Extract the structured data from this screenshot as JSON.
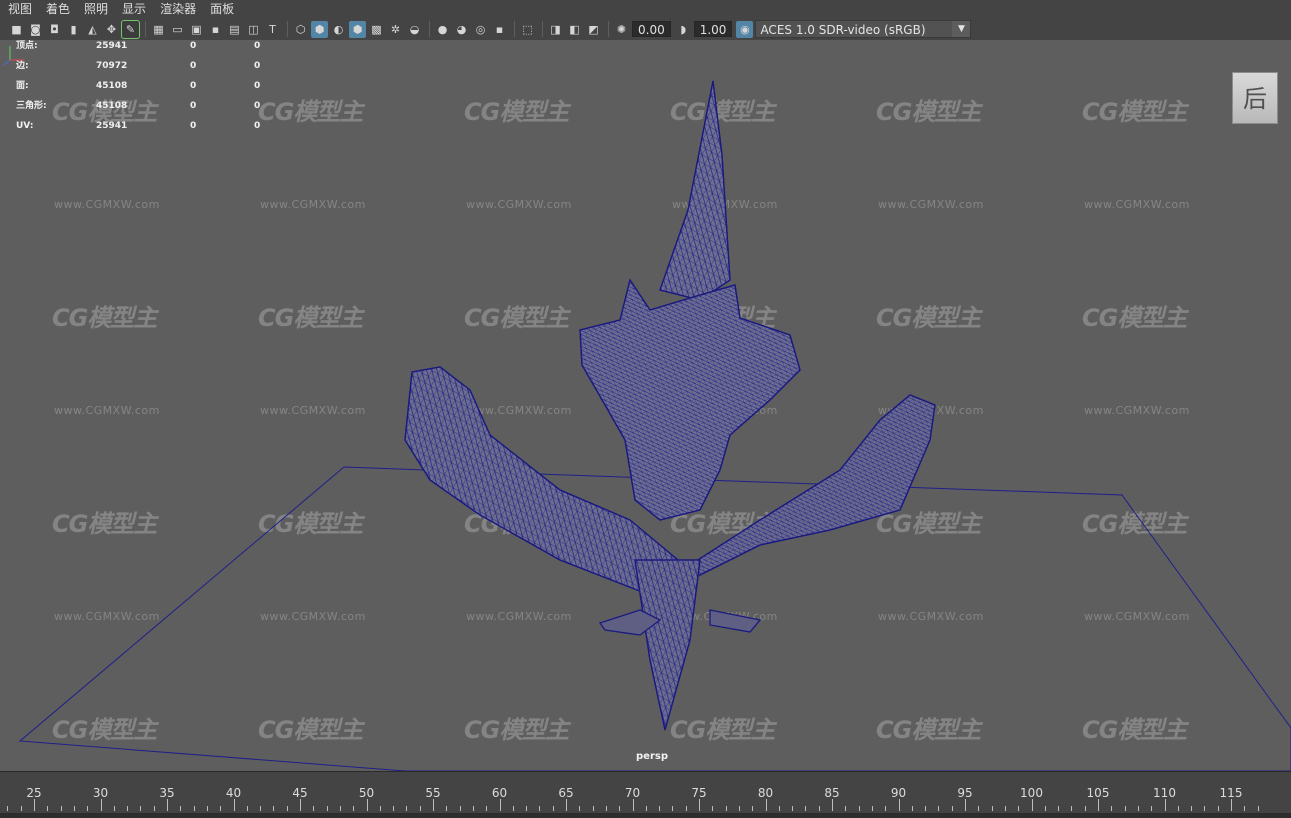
{
  "menu": [
    "视图",
    "着色",
    "照明",
    "显示",
    "渲染器",
    "面板"
  ],
  "toolbar": {
    "exposure": "0.00",
    "gamma": "1.00",
    "color_space": "ACES 1.0 SDR-video (sRGB)",
    "icons": [
      "camera-select-icon",
      "camera-attrs-icon",
      "bookmark-icon",
      "bookmark-add-icon",
      "image-plane-icon",
      "2d-pan-zoom-icon",
      "grease-pencil-icon",
      "grid-icon",
      "film-gate-icon",
      "resolution-gate-icon",
      "gate-mask-icon",
      "field-chart-icon",
      "safe-action-icon",
      "safe-title-icon",
      "wireframe-icon",
      "smooth-shade-icon",
      "default-material-icon",
      "wireframe-on-shaded-icon",
      "textured-icon",
      "use-lights-icon",
      "shadows-icon",
      "screen-space-ao-icon",
      "motion-blur-icon",
      "anti-aliasing-icon",
      "depth-of-field-icon",
      "isolate-select-icon",
      "xray-icon",
      "xray-joints-icon",
      "xray-components-icon",
      "exposure-icon",
      "gamma-icon",
      "color-management-icon"
    ],
    "active_icons": [
      "grease-pencil-icon",
      "smooth-shade-icon",
      "wireframe-on-shaded-icon"
    ]
  },
  "hud": [
    {
      "label": "顶点:",
      "v1": "25941",
      "v2": "0",
      "v3": "0"
    },
    {
      "label": "边:",
      "v1": "70972",
      "v2": "0",
      "v3": "0"
    },
    {
      "label": "面:",
      "v1": "45108",
      "v2": "0",
      "v3": "0"
    },
    {
      "label": "三角形:",
      "v1": "45108",
      "v2": "0",
      "v3": "0"
    },
    {
      "label": "UV:",
      "v1": "25941",
      "v2": "0",
      "v3": "0"
    }
  ],
  "view_cube": {
    "face": "后"
  },
  "camera_label": "persp",
  "watermark": {
    "logo": "CG模型主",
    "url": "www.CGMXW.com"
  },
  "timeline": {
    "ticks": [
      "25",
      "30",
      "35",
      "40",
      "45",
      "50",
      "55",
      "60",
      "65",
      "70",
      "75",
      "80",
      "85",
      "90",
      "95",
      "100",
      "105",
      "110",
      "115"
    ]
  },
  "colors": {
    "wire": "#1f1f8a",
    "viewport_bg": "#5e5e5e",
    "accent": "#5285a6"
  }
}
